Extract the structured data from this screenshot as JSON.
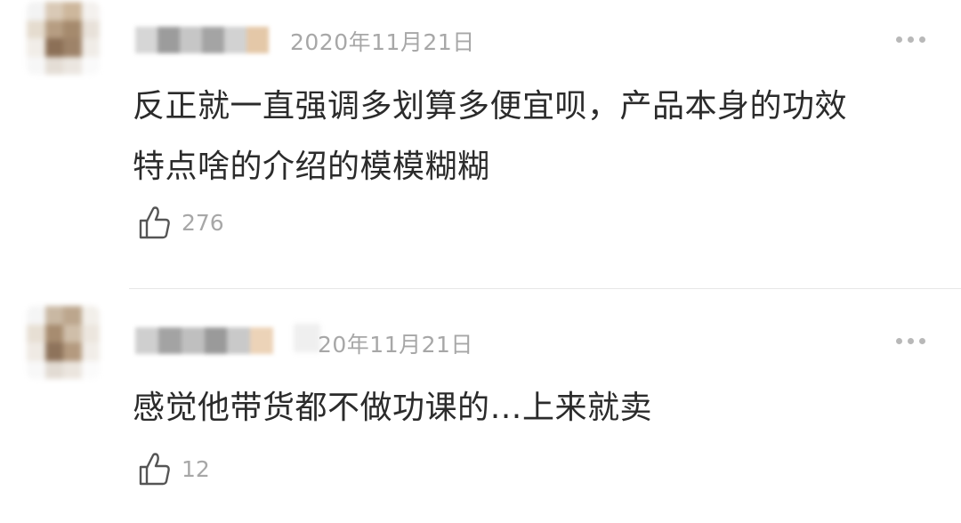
{
  "comments": [
    {
      "date": "2020年11月21日",
      "text": "反正就一直强调多划算多便宜呗，产品本身的功效\n特点啥的介绍的模模糊糊",
      "likes": "276"
    },
    {
      "date": "20年11月21日",
      "text": "感觉他带货都不做功课的…上来就卖",
      "likes": "12"
    }
  ],
  "icons": {
    "like": "thumbs-up-icon",
    "more": "more-dots-icon"
  },
  "colors": {
    "meta_gray": "#a7a7a7",
    "text": "#2b2b2b",
    "divider": "#e6e6e6"
  }
}
